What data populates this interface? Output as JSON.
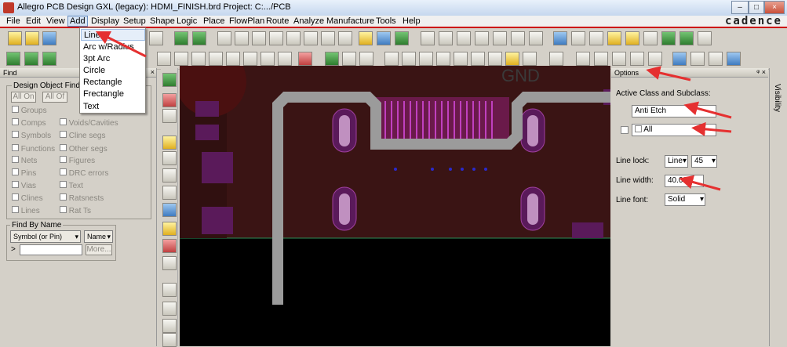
{
  "app": {
    "title": "Allegro PCB Design GXL (legacy): HDMI_FINISH.brd  Project: C:.../PCB",
    "brand": "cadence",
    "window_buttons": [
      "–",
      "□",
      "×"
    ]
  },
  "menu": [
    "File",
    "Edit",
    "View",
    "Add",
    "Display",
    "Setup",
    "Shape",
    "Logic",
    "Place",
    "FlowPlan",
    "Route",
    "Analyze",
    "Manufacture",
    "Tools",
    "Help"
  ],
  "add_menu": {
    "items": [
      "Line",
      "Arc w/Radius",
      "3pt Arc",
      "Circle",
      "Rectangle",
      "Frectangle",
      "Text"
    ],
    "selected": "Line"
  },
  "find_panel": {
    "title": "Find",
    "group_title": "Design Object Find",
    "all_on": "All On",
    "all_off": "All Of",
    "left_items": [
      "Groups",
      "Comps",
      "Symbols",
      "Functions",
      "Nets",
      "Pins",
      "Vias",
      "Clines",
      "Lines"
    ],
    "right_items": [
      "Voids/Cavities",
      "Cline segs",
      "Other segs",
      "Figures",
      "DRC errors",
      "Text",
      "Ratsnests",
      "Rat Ts"
    ],
    "find_by_name_title": "Find By Name",
    "find_by_name_type": "Symbol (or Pin)",
    "find_by_name_mode": "Name",
    "input_prefix": ">",
    "more": "More..."
  },
  "canvas": {
    "net_label": "GND",
    "colors": {
      "background": "#000000",
      "board": "#3a1414",
      "pad": "#5a1a5a",
      "trace": "#9b9b9b",
      "via": "#2a2acc"
    }
  },
  "options_panel": {
    "title": "Options",
    "active_class_label": "Active Class and Subclass:",
    "class_value": "Anti Etch",
    "subclass_value": "All",
    "line_lock_label": "Line lock:",
    "line_lock_value": "Line",
    "line_lock_angle": "45",
    "line_width_label": "Line width:",
    "line_width_value": "40.00",
    "line_font_label": "Line font:",
    "line_font_value": "Solid"
  },
  "visibility_tab": "Visibility"
}
